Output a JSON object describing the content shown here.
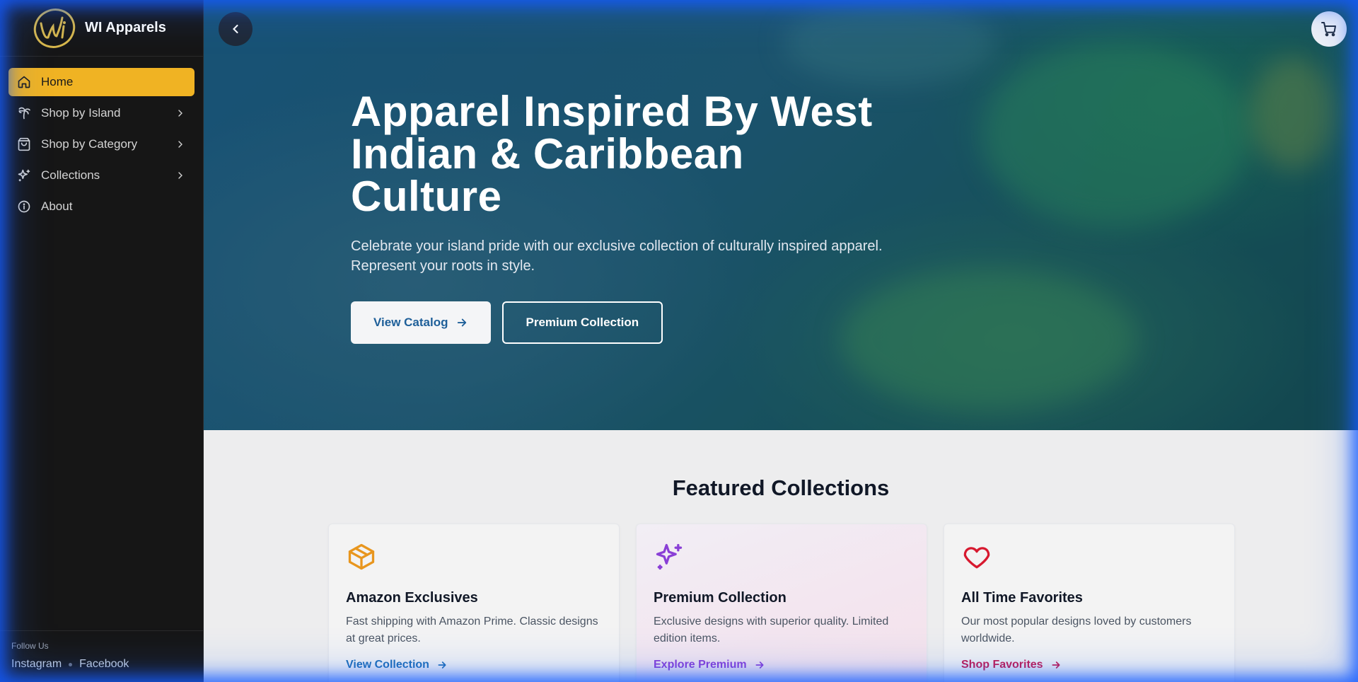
{
  "brand": {
    "name": "WI Apparels",
    "logo_text": "Wi",
    "logo_color": "#d9b84a"
  },
  "sidebar": {
    "items": [
      {
        "label": "Home",
        "icon": "home-icon",
        "active": true,
        "has_submenu": false
      },
      {
        "label": "Shop by Island",
        "icon": "palm-tree-icon",
        "active": false,
        "has_submenu": true
      },
      {
        "label": "Shop by Category",
        "icon": "shopping-bag-icon",
        "active": false,
        "has_submenu": true
      },
      {
        "label": "Collections",
        "icon": "sparkles-icon",
        "active": false,
        "has_submenu": true
      },
      {
        "label": "About",
        "icon": "info-icon",
        "active": false,
        "has_submenu": false
      }
    ],
    "footer": {
      "label": "Follow Us",
      "links": [
        "Instagram",
        "Facebook"
      ]
    }
  },
  "hero": {
    "title": "Apparel Inspired By West Indian & Caribbean Culture",
    "subtitle": "Celebrate your island pride with our exclusive collection of culturally inspired apparel. Represent your roots in style.",
    "primary_button": "View Catalog",
    "secondary_button": "Premium Collection"
  },
  "featured": {
    "title": "Featured Collections",
    "cards": [
      {
        "title": "Amazon Exclusives",
        "description": "Fast shipping with Amazon Prime. Classic designs at great prices.",
        "link": "View Collection",
        "icon": "package-icon",
        "accent": "#e8961e",
        "link_color": "#1f6fb5"
      },
      {
        "title": "Premium Collection",
        "description": "Exclusive designs with superior quality. Limited edition items.",
        "link": "Explore Premium",
        "icon": "sparkles-icon",
        "accent": "#8a3fd6",
        "link_color": "#8a3fd6"
      },
      {
        "title": "All Time Favorites",
        "description": "Our most popular designs loved by customers worldwide.",
        "link": "Shop Favorites",
        "icon": "heart-icon",
        "accent": "#d7192f",
        "link_color": "#c8184d"
      }
    ]
  },
  "colors": {
    "active_nav": "#f0b323",
    "sidebar_bg": "#161616",
    "glow": "#145aff"
  }
}
